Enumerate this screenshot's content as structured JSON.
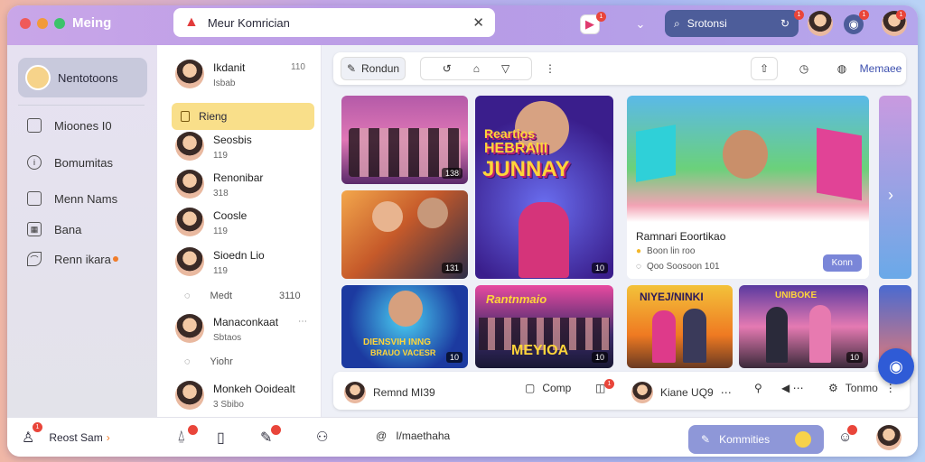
{
  "app": {
    "title": "Meing"
  },
  "urlbar": {
    "text": "Meur Komrician"
  },
  "search": {
    "label": "Srotonsi"
  },
  "topbar": {
    "badges": [
      "1",
      "1",
      "1",
      "1"
    ]
  },
  "sidebar": {
    "profile_name": "Nentotoons",
    "items": [
      {
        "label": "Mioones I0",
        "icon": "calendar-icon"
      },
      {
        "label": "Bomumitas",
        "icon": "info-icon"
      },
      {
        "label": "Menn Nams",
        "icon": "bookmark-icon"
      },
      {
        "label": "Bana",
        "icon": "grid-icon"
      },
      {
        "label": "Renn ikara",
        "icon": "leaf-icon"
      }
    ],
    "footer_label": "Reost Sam"
  },
  "people": {
    "list": [
      {
        "name": "Ikdanit",
        "sub": "Isbab",
        "time": "110"
      },
      {
        "name": "Seosbis",
        "sub": "119"
      },
      {
        "name": "Renonibar",
        "sub": "318"
      },
      {
        "name": "Coosle",
        "sub": "119"
      },
      {
        "name": "Sioedn Lio",
        "sub": "119"
      },
      {
        "name": "Manaconkaat",
        "sub": "Sbtaos"
      },
      {
        "name": "Monkeh Ooidealt",
        "sub": "3 Sbibo"
      }
    ],
    "highlight": "Rieng",
    "row_meta": {
      "left": "Medt",
      "time": "3110"
    },
    "row_meta2": {
      "left": "Yiohr"
    }
  },
  "toolbar": {
    "search_btn": "Rondun",
    "right_label": "Memaee"
  },
  "tiles": {
    "t1_tag": "138",
    "t2_big1": "Reartios",
    "t2_big2": "HEBRAIII",
    "t2_big3": "JUNNAY",
    "t2_tag": "10",
    "t3_title": "Ramnari Eoortikao",
    "t3_sub": "Boon lin roo",
    "t3_meta": "Qoo Soosoon 101",
    "t3_btn": "Konn",
    "t4_tag": "131",
    "t5_big": "DIENSVIH INNG",
    "t5_sub": "BRAUO VACESR",
    "t5_tag": "10",
    "t6_big1": "Rantnmaio",
    "t6_big2": "MEYIOA",
    "t6_tag": "10",
    "t7_big": "NIYEJ/NINKI",
    "t8_big": "UNIBOKE",
    "t8_tag": "10"
  },
  "chatbar": {
    "left_name": "Remnd MI39",
    "center": "Comp",
    "center_badge": "1",
    "right_name": "Kiane UQ9",
    "end_label": "Tonmo"
  },
  "bottombar": {
    "middle_label": "I/maethaha",
    "communities": "Kommities"
  },
  "colors": {
    "accent": "#8e97d8",
    "highlight": "#f9df8a",
    "badge": "#e9453a",
    "fab": "#2f5bd6"
  }
}
